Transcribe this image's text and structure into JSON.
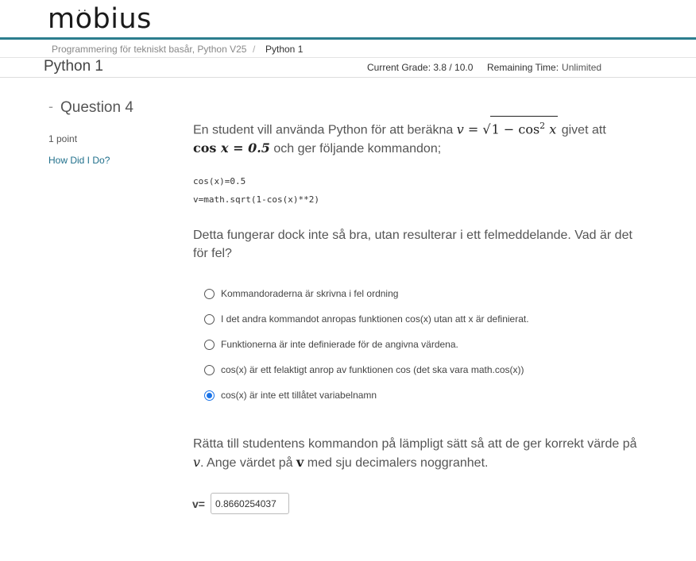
{
  "header": {
    "logo_prefix": "m",
    "logo_o": "o",
    "logo_dots": "..",
    "logo_suffix": "bius"
  },
  "breadcrumb": {
    "course": "Programmering för tekniskt basår, Python V25",
    "separator": "/",
    "current": "Python 1"
  },
  "assignment": {
    "title": "Python 1",
    "current_grade": "Current Grade: 3.8 / 10.0",
    "remaining_time_label": "Remaining Time:",
    "remaining_time_value": "Unlimited"
  },
  "question": {
    "dash": "-",
    "title": "Question 4",
    "points": "1 point",
    "how_did_i_do": "How Did I Do?",
    "intro_text_1": "En student vill använda Python för att beräkna",
    "intro_math_v": "v",
    "intro_math_eq": " = ",
    "intro_math_sqrt": "1 − cos",
    "intro_math_sup": "2",
    "intro_math_x": " x",
    "intro_text_2": " givet att",
    "intro_math_cos": "cos",
    "intro_math_cond": " x = 0.5",
    "intro_text_3": " och ger följande kommandon;",
    "code_line_1": "cos(x)=0.5",
    "code_line_2": "v=math.sqrt(1-cos(x)**2)",
    "problem_text": "Detta fungerar dock inte så bra, utan resulterar i ett felmeddelande. Vad är det för fel?",
    "options": [
      {
        "label": "Kommandoraderna är skrivna i fel ordning",
        "selected": false
      },
      {
        "label": "I det andra kommandot anropas funktionen cos(x) utan att x är definierat.",
        "selected": false
      },
      {
        "label": "Funktionerna är inte definierade för de angivna värdena.",
        "selected": false
      },
      {
        "label": "cos(x) är ett felaktigt anrop av funktionen cos (det ska vara math.cos(x))",
        "selected": false
      },
      {
        "label": "cos(x) är inte ett tillåtet variabelnamn",
        "selected": true
      }
    ],
    "fix_text_1": "Rätta till studentens kommandon på lämpligt sätt så att de ger korrekt värde på",
    "fix_math_v": "v",
    "fix_text_2": ". Ange värdet på",
    "fix_bold_v": "v",
    "fix_text_3": " med sju decimalers noggranhet.",
    "answer_label": "v=",
    "answer_value": "0.8660254037"
  }
}
